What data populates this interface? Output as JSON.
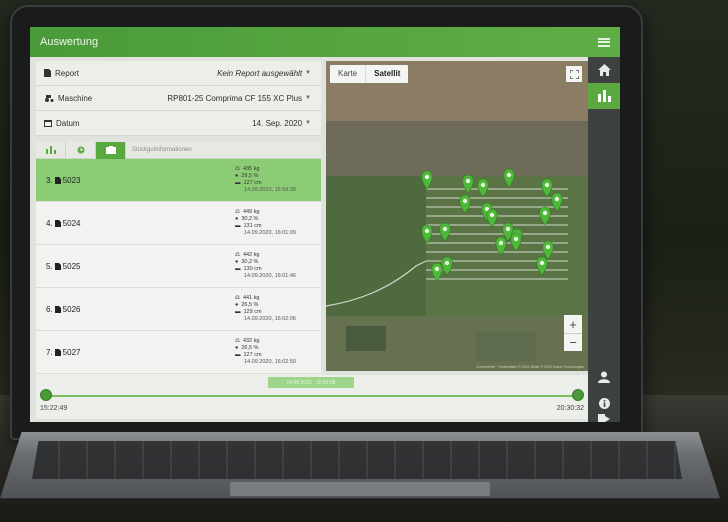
{
  "app": {
    "title": "Auswertung"
  },
  "filters": [
    {
      "label": "Report",
      "icon": "document-icon",
      "value": "Kein Report ausgewählt",
      "italic": true
    },
    {
      "label": "Maschine",
      "icon": "tractor-icon",
      "value": "RP801-25 Comprima CF 155 XC Plus",
      "italic": false
    },
    {
      "label": "Datum",
      "icon": "calendar-icon",
      "value": "14. Sep. 2020",
      "italic": false
    }
  ],
  "tabs": {
    "active_label": "Stückgutinformationen"
  },
  "list": [
    {
      "id": "3.",
      "number": "5023",
      "weight": "435 kg",
      "moisture": "29,5 %",
      "size": "127 cm",
      "timestamp": "14.09.2020, 15:59:28",
      "selected": true
    },
    {
      "id": "4.",
      "number": "5024",
      "weight": "449 kg",
      "moisture": "30,2 %",
      "size": "131 cm",
      "timestamp": "14.09.2020, 16:01:09",
      "selected": false
    },
    {
      "id": "5.",
      "number": "5025",
      "weight": "442 kg",
      "moisture": "30,2 %",
      "size": "130 cm",
      "timestamp": "14.09.2020, 16:01:46",
      "selected": false
    },
    {
      "id": "6.",
      "number": "5026",
      "weight": "441 kg",
      "moisture": "26,5 %",
      "size": "129 cm",
      "timestamp": "14.09.2020, 16:02:06",
      "selected": false
    },
    {
      "id": "7.",
      "number": "5027",
      "weight": "432 kg",
      "moisture": "26,5 %",
      "size": "127 cm",
      "timestamp": "14.09.2020, 16:02:50",
      "selected": false
    }
  ],
  "map": {
    "mode_options": [
      "Karte",
      "Satellit"
    ],
    "active_mode": "Satellit",
    "zoom_in": "+",
    "zoom_out": "−",
    "attribution": "Kurzbefehle · Kartendaten © 2020 Bilder © 2020 Maxar Technologies"
  },
  "timeline": {
    "chip_label": "14.09.2020 · 15:59:28",
    "start": "15:22:49",
    "end": "20:30:32"
  },
  "colors": {
    "accent": "#5aa840",
    "selected_row": "#8ccc74",
    "pin": "#4fb83a"
  }
}
